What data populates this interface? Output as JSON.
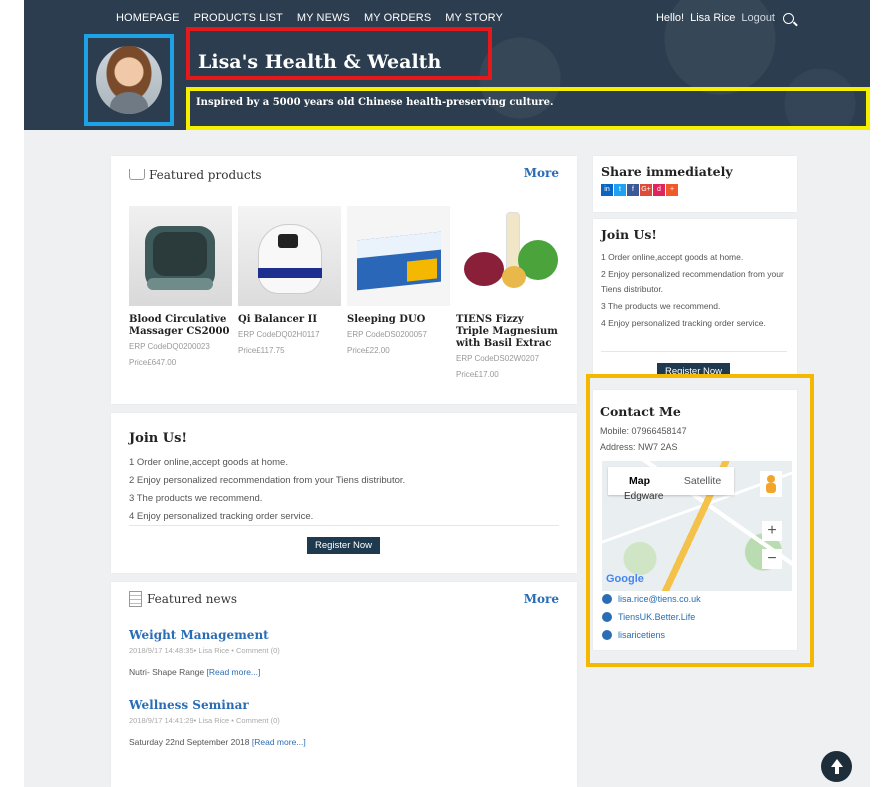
{
  "nav": {
    "items": [
      "HOMEPAGE",
      "PRODUCTS LIST",
      "MY NEWS",
      "MY ORDERS",
      "MY STORY"
    ],
    "greeting": "Hello!",
    "user_name": "Lisa Rice",
    "logout": "Logout",
    "search_icon": "search-icon"
  },
  "header": {
    "title": "Lisa's Health & Wealth",
    "tagline": "Inspired by a 5000 years old Chinese health-preserving culture.",
    "highlight_colors": {
      "avatar": "#1ea2e6",
      "title": "#e5181b",
      "tagline": "#f7ef00",
      "contact": "#f5b800"
    }
  },
  "featured_products": {
    "title": "Featured products",
    "more": "More",
    "items": [
      {
        "name": "Blood Circulative Massager CS2000",
        "code": "ERP CodeDQ0200023",
        "price": "Price£647.00"
      },
      {
        "name": "Qi Balancer II",
        "code": "ERP CodeDQ02H0117",
        "price": "Price£117.75"
      },
      {
        "name": "Sleeping DUO",
        "code": "ERP CodeDS0200057",
        "price": "Price£22.00"
      },
      {
        "name": "TIENS Fizzy Triple Magnesium with Basil Extrac",
        "code": "ERP CodeDS02W0207",
        "price": "Price£17.00"
      }
    ]
  },
  "join_main": {
    "title": "Join Us!",
    "items": [
      "1 Order online,accept goods at home.",
      "2 Enjoy personalized recommendation from your Tiens distributor.",
      "3 The products we recommend.",
      "4 Enjoy personalized tracking order service."
    ],
    "button": "Register Now"
  },
  "featured_news": {
    "title": "Featured news",
    "more": "More",
    "items": [
      {
        "title": "Weight Management",
        "meta": "2018/9/17 14:48:35• Lisa Rice • Comment (0)",
        "excerpt": "Nutri- Shape Range",
        "read_more": "[Read more...]"
      },
      {
        "title": "Wellness Seminar",
        "meta": "2018/9/17 14:41:29• Lisa Rice • Comment (0)",
        "excerpt": "Saturday 22nd September 2018",
        "read_more": "[Read more...]"
      }
    ]
  },
  "share": {
    "title": "Share immediately",
    "icons": [
      {
        "label": "in",
        "color": "#0a66c2"
      },
      {
        "label": "t",
        "color": "#1da1f2"
      },
      {
        "label": "f",
        "color": "#3b5998"
      },
      {
        "label": "G+",
        "color": "#dd4b39"
      },
      {
        "label": "d",
        "color": "#e0245e"
      },
      {
        "label": "+",
        "color": "#f05a28"
      }
    ]
  },
  "join_side": {
    "title": "Join Us!",
    "items": [
      "1 Order online,accept goods at home.",
      "2 Enjoy personalized recommendation from your Tiens distributor.",
      "3 The products we recommend.",
      "4 Enjoy personalized tracking order service."
    ],
    "button": "Register Now"
  },
  "contact": {
    "title": "Contact Me",
    "mobile": "Mobile: 07966458147",
    "address": "Address: NW7 2AS",
    "map": {
      "tab_map": "Map",
      "tab_satellite": "Satellite",
      "place": "Edgware",
      "google": "Google",
      "zoom_in": "+",
      "zoom_out": "−"
    },
    "email": "lisa.rice@tiens.co.uk",
    "facebook": "TiensUK.Better.Life",
    "instagram": "lisaricetiens"
  }
}
